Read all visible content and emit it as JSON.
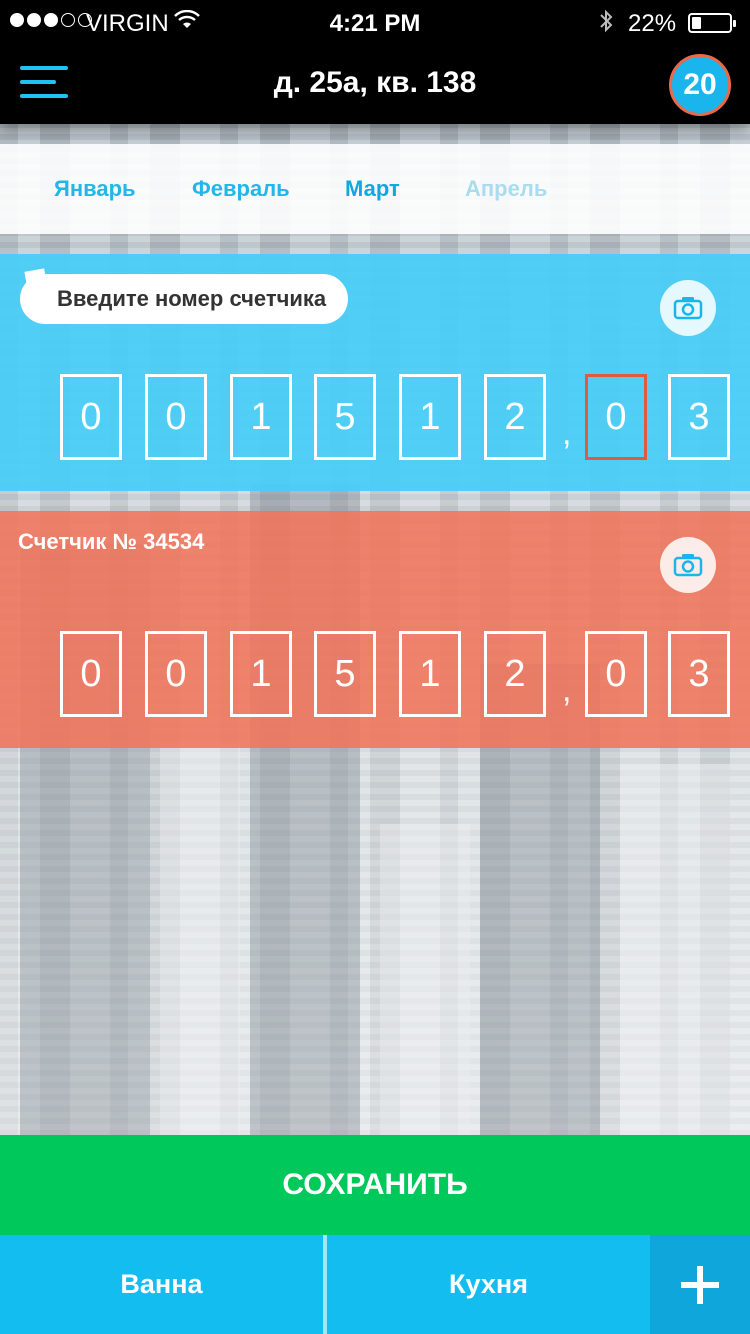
{
  "status_bar": {
    "carrier": "VIRGIN",
    "time": "4:21 PM",
    "battery": "22%",
    "battery_level": 0.22
  },
  "header": {
    "title": "д. 25а, кв. 138",
    "badge_count": "20"
  },
  "months": [
    {
      "label": "Январь"
    },
    {
      "label": "Февраль"
    },
    {
      "label": "Март"
    },
    {
      "label": "Апрель"
    }
  ],
  "meters": [
    {
      "label": "Введите номер счетчика",
      "digits": [
        "0",
        "0",
        "1",
        "5",
        "1",
        "2"
      ],
      "separator": ",",
      "decimals": [
        "0",
        "3"
      ],
      "color": "#47cdf7"
    },
    {
      "label": "Счетчик № 34534",
      "digits": [
        "0",
        "0",
        "1",
        "5",
        "1",
        "2"
      ],
      "separator": ",",
      "decimals": [
        "0",
        "3"
      ],
      "color": "#f0745a"
    }
  ],
  "save_label": "СОХРАНИТЬ",
  "tabs": [
    {
      "label": "Ванна"
    },
    {
      "label": "Кухня"
    }
  ],
  "icons": {
    "menu": "hamburger-icon",
    "camera": "camera-icon",
    "add": "plus-icon"
  },
  "colors": {
    "accent": "#1ec2f3",
    "save": "#00c85a",
    "selected_border": "#e05a3c"
  }
}
